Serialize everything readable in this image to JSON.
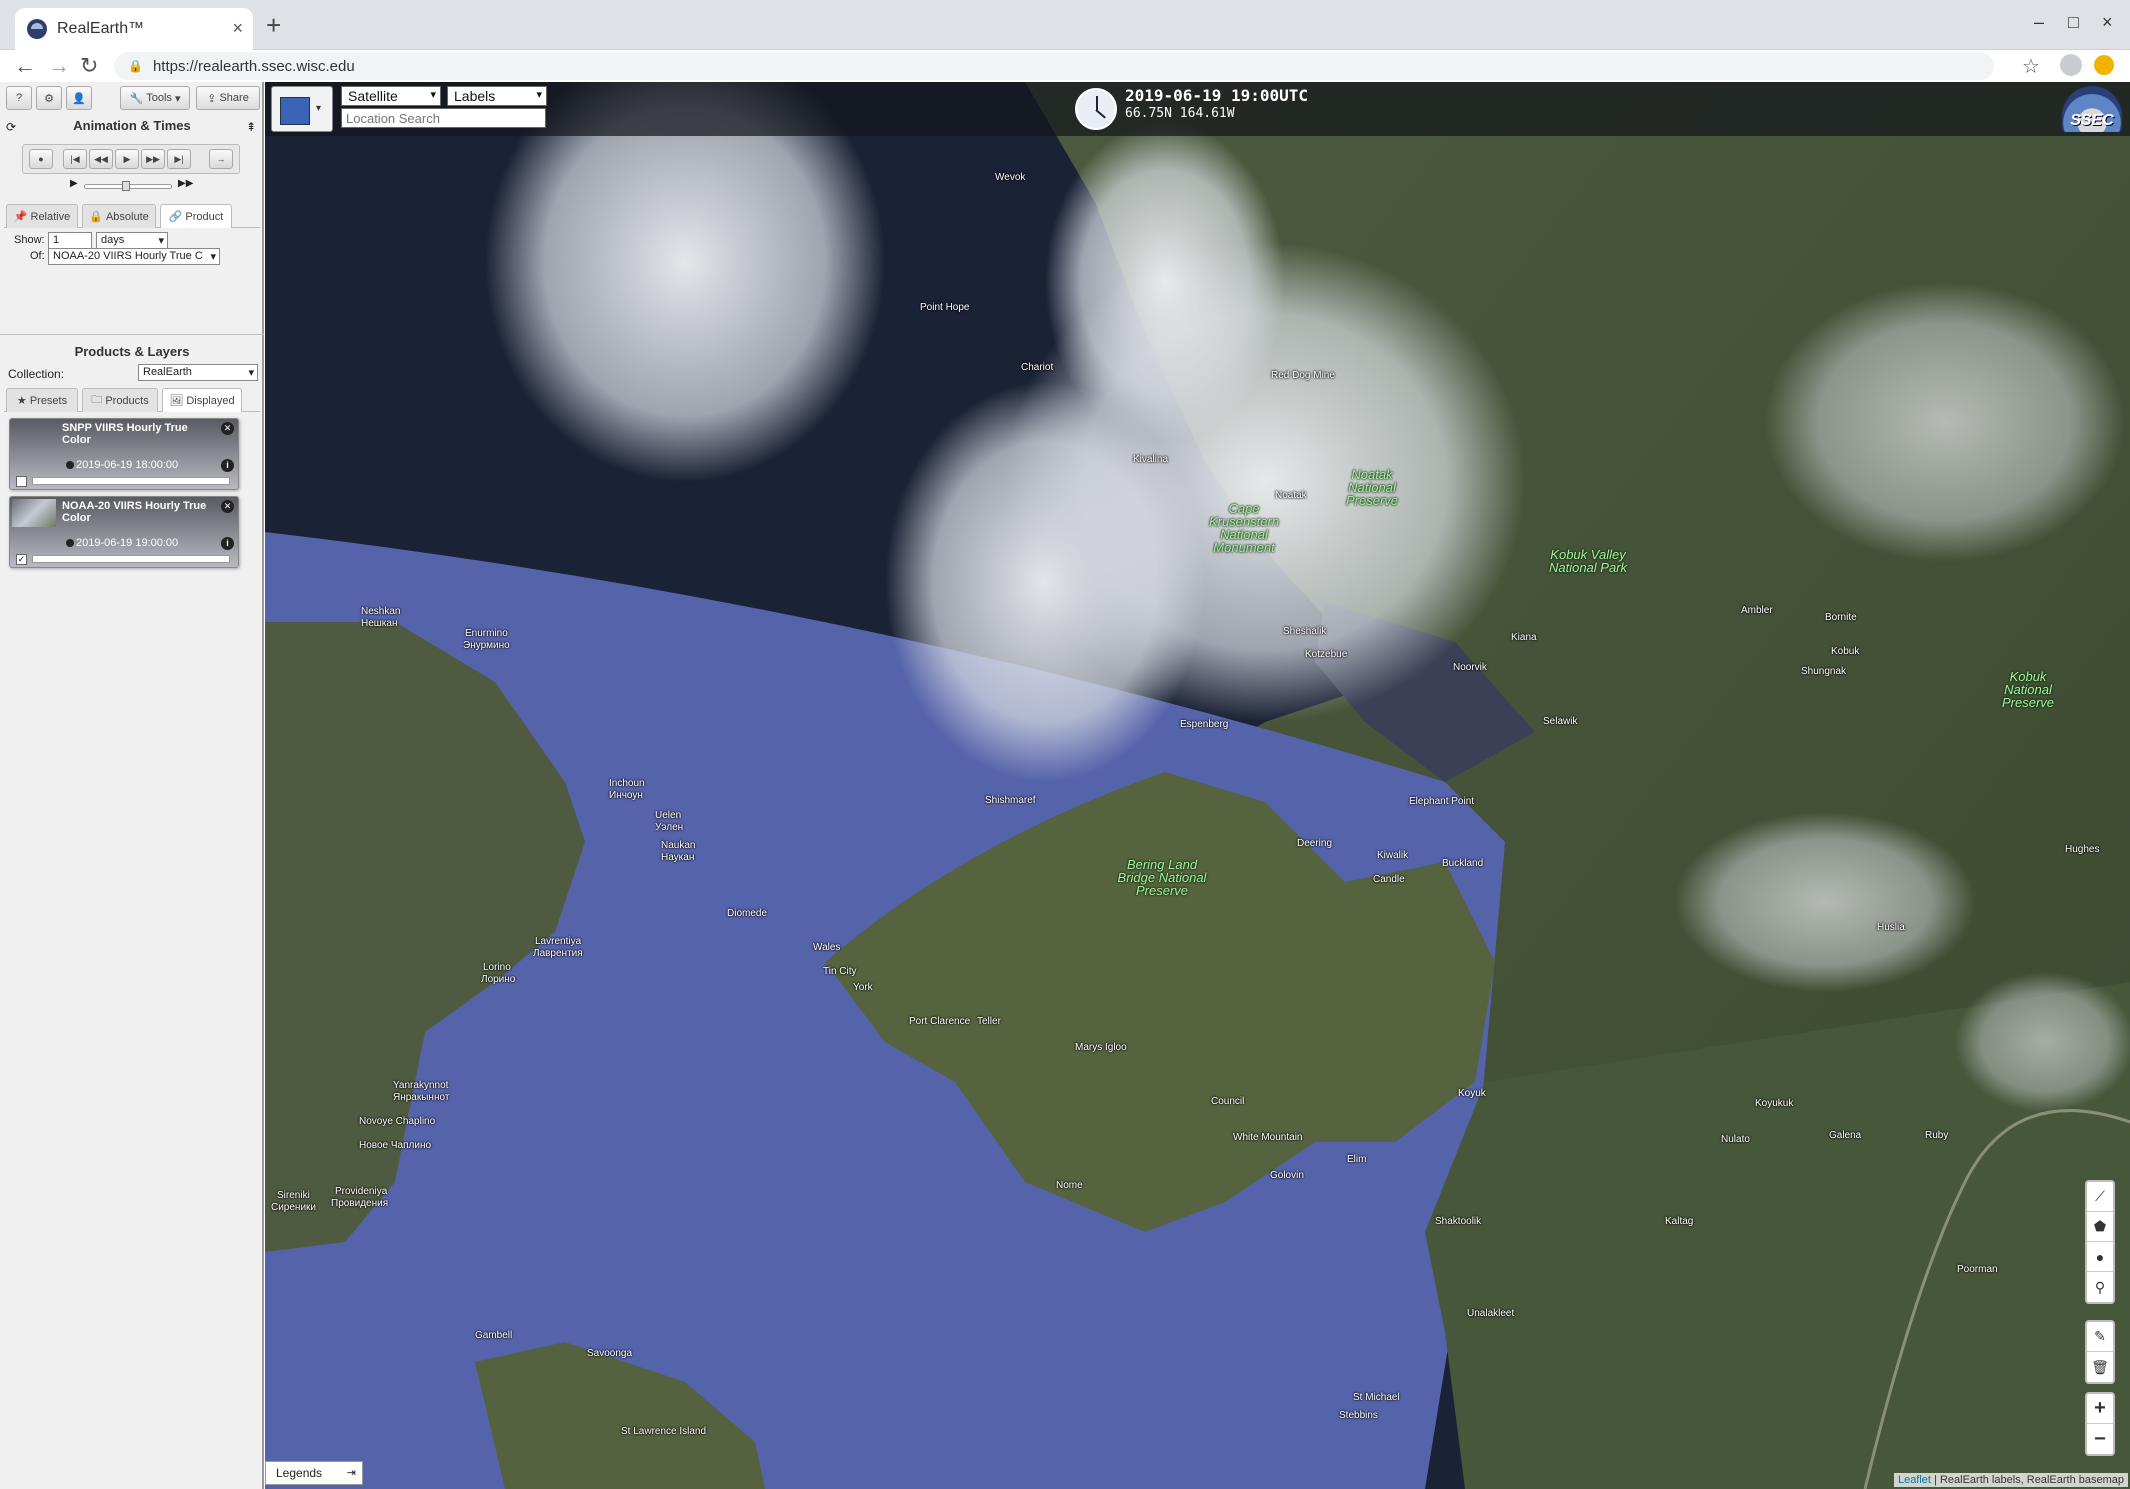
{
  "browser": {
    "tab_title": "RealEarth™",
    "tab_close": "×",
    "new_tab": "+",
    "url": "https://realearth.ssec.wisc.edu",
    "window_controls": [
      "–",
      "□",
      "×"
    ]
  },
  "toolbar": {
    "help": "?",
    "settings": "⚙",
    "user": "👤",
    "tools": "Tools",
    "share": "Share"
  },
  "animation": {
    "title": "Animation & Times",
    "buttons": [
      "●",
      "|◀",
      "◀◀",
      "▶",
      "▶▶",
      "▶|",
      "→"
    ],
    "tabs": [
      {
        "label": "Relative",
        "active": false
      },
      {
        "label": "Absolute",
        "active": false
      },
      {
        "label": "Product",
        "active": true
      }
    ],
    "show_label": "Show:",
    "show_value": "1",
    "show_unit": "days",
    "of_label": "Of:",
    "of_value": "NOAA-20 VIIRS Hourly True C"
  },
  "products": {
    "title": "Products & Layers",
    "collection_label": "Collection:",
    "collection_value": "RealEarth",
    "tabs": [
      {
        "label": "Presets",
        "active": false
      },
      {
        "label": "Products",
        "active": false
      },
      {
        "label": "Displayed",
        "active": true
      }
    ],
    "layers": [
      {
        "name": "SNPP VIIRS Hourly True Color",
        "time": "2019-06-19 18:00:00",
        "checked": false
      },
      {
        "name": "NOAA-20 VIIRS Hourly True Color",
        "time": "2019-06-19 19:00:00",
        "checked": true
      }
    ]
  },
  "map": {
    "base_select": "Satellite",
    "labels_select": "Labels",
    "search_placeholder": "Location Search",
    "datetime": "2019-06-19 19:00UTC",
    "coords": "66.75N 164.61W",
    "logo_text": "SSEC",
    "legends": "Legends",
    "attribution_link": "Leaflet",
    "attribution_text": " | RealEarth labels, RealEarth basemap",
    "places": [
      {
        "name": "Wevok"
      },
      {
        "name": "Point Hope"
      },
      {
        "name": "Chariot"
      },
      {
        "name": "Red Dog Mine"
      },
      {
        "name": "Kivalina"
      },
      {
        "name": "Noatak"
      },
      {
        "name": "Sheshalik"
      },
      {
        "name": "Kotzebue"
      },
      {
        "name": "Kiana"
      },
      {
        "name": "Noorvik"
      },
      {
        "name": "Ambler"
      },
      {
        "name": "Bornite"
      },
      {
        "name": "Kobuk"
      },
      {
        "name": "Shungnak"
      },
      {
        "name": "Selawik"
      },
      {
        "name": "Espenberg"
      },
      {
        "name": "Shishmaref"
      },
      {
        "name": "Elephant Point"
      },
      {
        "name": "Deering"
      },
      {
        "name": "Kiwalik"
      },
      {
        "name": "Candle"
      },
      {
        "name": "Buckland"
      },
      {
        "name": "Hughes"
      },
      {
        "name": "Huslia"
      },
      {
        "name": "Neshkan"
      },
      {
        "name": "Нешкан"
      },
      {
        "name": "Enurmino"
      },
      {
        "name": "Энурмино"
      },
      {
        "name": "Inchoun"
      },
      {
        "name": "Инчоун"
      },
      {
        "name": "Uelen"
      },
      {
        "name": "Уэлен"
      },
      {
        "name": "Naukan"
      },
      {
        "name": "Наукан"
      },
      {
        "name": "Diomede"
      },
      {
        "name": "Wales"
      },
      {
        "name": "Tin City"
      },
      {
        "name": "York"
      },
      {
        "name": "Port Clarence"
      },
      {
        "name": "Teller"
      },
      {
        "name": "Lavrentiya"
      },
      {
        "name": "Лаврентия"
      },
      {
        "name": "Lorino"
      },
      {
        "name": "Лорино"
      },
      {
        "name": "Marys Igloo"
      },
      {
        "name": "Council"
      },
      {
        "name": "White Mountain"
      },
      {
        "name": "Elim"
      },
      {
        "name": "Golovin"
      },
      {
        "name": "Nome"
      },
      {
        "name": "Koyuk"
      },
      {
        "name": "Koyukuk"
      },
      {
        "name": "Nulato"
      },
      {
        "name": "Galena"
      },
      {
        "name": "Ruby"
      },
      {
        "name": "Kaltag"
      },
      {
        "name": "Shaktoolik"
      },
      {
        "name": "Poorman"
      },
      {
        "name": "Unalakleet"
      },
      {
        "name": "Yanrakynnot"
      },
      {
        "name": "Янракыннот"
      },
      {
        "name": "Novoye Chaplino"
      },
      {
        "name": "Новое Чаплино"
      },
      {
        "name": "Sireniki"
      },
      {
        "name": "Сиреники"
      },
      {
        "name": "Provideniya"
      },
      {
        "name": "Провидения"
      },
      {
        "name": "Gambell"
      },
      {
        "name": "Savoonga"
      },
      {
        "name": "St Lawrence Island"
      },
      {
        "name": "St Michael"
      },
      {
        "name": "Stebbins"
      }
    ],
    "parks": [
      {
        "name": "Noatak National Preserve"
      },
      {
        "name": "Cape Krusenstern National Monument"
      },
      {
        "name": "Kobuk Valley National Park"
      },
      {
        "name": "Kobuk National Preserve"
      },
      {
        "name": "Bering Land Bridge National Preserve"
      }
    ]
  }
}
